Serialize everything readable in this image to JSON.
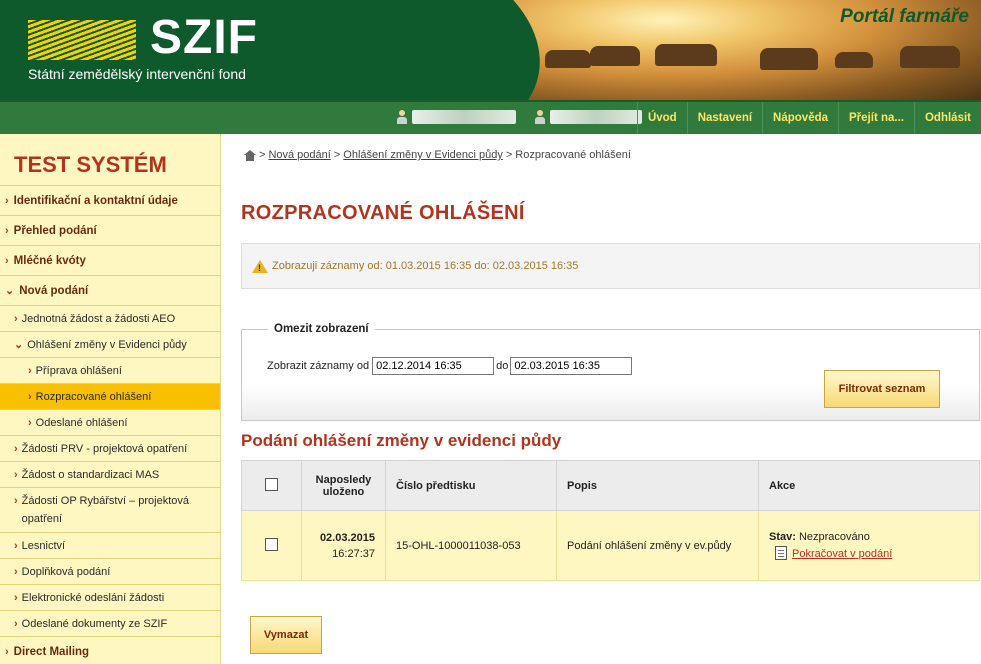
{
  "header": {
    "logo_text": "SZIF",
    "logo_subtitle": "Státní zemědělský intervenční fond",
    "portal_label": "Portál farmáře"
  },
  "navbar": {
    "menu": [
      "Úvod",
      "Nastavení",
      "Nápověda",
      "Přejít na...",
      "Odhlásit"
    ]
  },
  "sidebar": {
    "system_title": "TEST SYSTÉM",
    "items": [
      {
        "label": "Identifikační a kontaktní údaje"
      },
      {
        "label": "Přehled podání"
      },
      {
        "label": "Mléčné kvóty"
      },
      {
        "label": "Nová podání"
      }
    ],
    "subitems": [
      {
        "label": "Jednotná žádost a žádosti AEO"
      },
      {
        "label": "Ohlášení změny v Evidenci půdy"
      },
      {
        "label": "Příprava ohlášení"
      },
      {
        "label": "Rozpracované ohlášení"
      },
      {
        "label": "Odeslané ohlášení"
      },
      {
        "label": "Žádosti PRV - projektová opatření"
      },
      {
        "label": "Žádost o standardizaci MAS"
      },
      {
        "label": "Žádosti OP Rybářství – projektová opatření"
      },
      {
        "label": "Lesnictví"
      },
      {
        "label": "Doplňková podání"
      },
      {
        "label": "Elektronické odeslání žádosti"
      },
      {
        "label": "Odeslané dokumenty ze SZIF"
      }
    ],
    "last_item": "Direct Mailing"
  },
  "breadcrumb": {
    "items": [
      "Nová podání",
      "Ohlášení změny v Evidenci půdy",
      "Rozpracované ohlášení"
    ],
    "separator": ">"
  },
  "page_title": "ROZPRACOVANÉ OHLÁŠENÍ",
  "notice": "Zobrazuji záznamy od: 01.03.2015 16:35 do: 02.03.2015 16:35",
  "filter": {
    "legend": "Omezit zobrazení",
    "from_label": "Zobrazit záznamy od",
    "from_value": "02.12.2014 16:35",
    "to_label": "do",
    "to_value": "02.03.2015 16:35",
    "button": "Filtrovat seznam"
  },
  "section_title": "Podání ohlášení změny v evidenci půdy",
  "table": {
    "headers": [
      "Naposledy uloženo",
      "Číslo předtisku",
      "Popis",
      "Akce"
    ],
    "rows": [
      {
        "date": "02.03.2015",
        "time": "16:27:37",
        "number": "15-OHL-1000011038-053",
        "description": "Podání ohlášení změny v ev.půdy",
        "status_label": "Stav:",
        "status_value": "Nezpracováno",
        "action": "Pokračovat v podání"
      }
    ]
  },
  "delete_button": "Vymazat"
}
